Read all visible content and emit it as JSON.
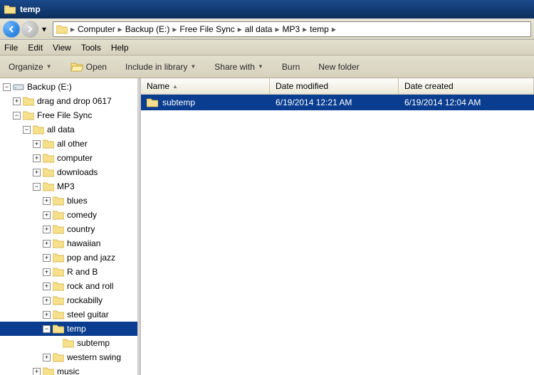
{
  "title": "temp",
  "breadcrumb": [
    "Computer",
    "Backup (E:)",
    "Free File Sync",
    "all data",
    "MP3",
    "temp"
  ],
  "menu": {
    "file": "File",
    "edit": "Edit",
    "view": "View",
    "tools": "Tools",
    "help": "Help"
  },
  "toolbar": {
    "organize": "Organize",
    "open": "Open",
    "include": "Include in library",
    "share": "Share with",
    "burn": "Burn",
    "newfolder": "New folder"
  },
  "tree": {
    "root": "Backup (E:)",
    "items": [
      "drag and drop 0617",
      "Free File Sync",
      "all data",
      "all other",
      "computer",
      "downloads",
      "MP3",
      "blues",
      "comedy",
      "country",
      "hawaiian",
      "pop and jazz",
      "R and B",
      "rock and roll",
      "rockabilly",
      "steel guitar",
      "temp",
      "subtemp",
      "western swing",
      "music"
    ]
  },
  "columns": {
    "name": "Name",
    "modified": "Date modified",
    "created": "Date created"
  },
  "rows": [
    {
      "name": "subtemp",
      "modified": "6/19/2014 12:21 AM",
      "created": "6/19/2014 12:04 AM"
    }
  ]
}
